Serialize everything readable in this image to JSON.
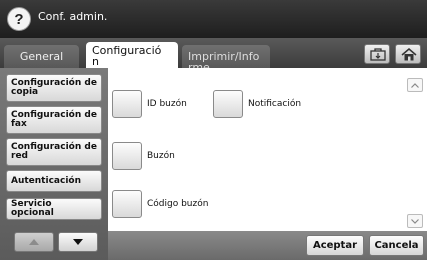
{
  "header": {
    "help_symbol": "?",
    "title": "Conf. admin."
  },
  "tabs": [
    {
      "label": "General"
    },
    {
      "label": "Configuració\nn"
    },
    {
      "label": "Imprimir/Info\nrme"
    }
  ],
  "tab_icons": [
    "document-icon",
    "home-icon"
  ],
  "sidebar": {
    "items": [
      {
        "label": "Configuración de copia"
      },
      {
        "label": "Configuración de fax"
      },
      {
        "label": "Configuración de red"
      },
      {
        "label": "Autenticación"
      },
      {
        "label": "Servicio opcional"
      }
    ]
  },
  "options": [
    {
      "label": "ID buzón"
    },
    {
      "label": "Notificación"
    },
    {
      "label": "Buzón"
    },
    {
      "label": "Código buzón"
    }
  ],
  "footer": {
    "accept_label": "Aceptar",
    "cancel_label": "Cancela"
  }
}
